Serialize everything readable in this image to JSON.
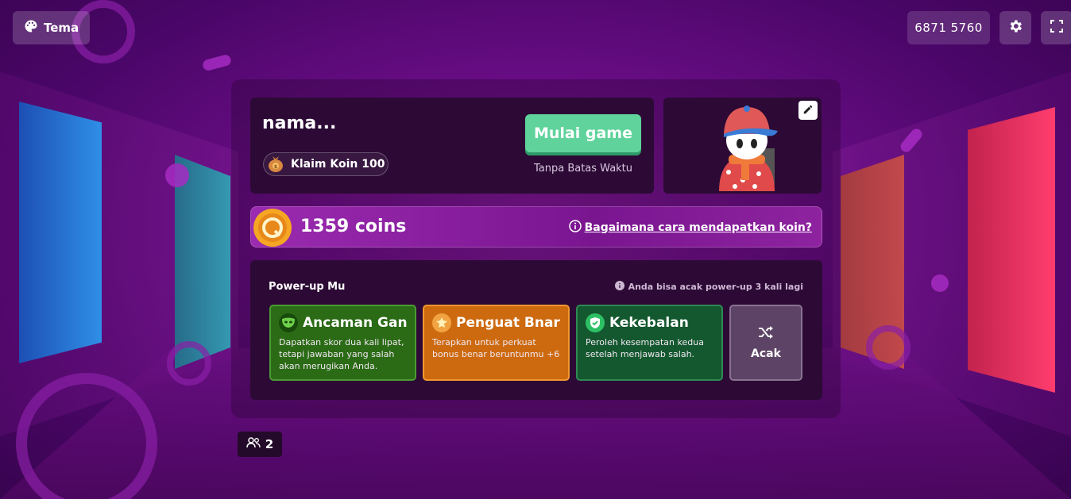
{
  "topbar": {
    "theme_label": "Tema",
    "game_code": "6871 5760"
  },
  "profile": {
    "name": "nama...",
    "claim_label": "Klaim Koin 100",
    "start_label": "Mulai game",
    "time_label": "Tanpa Batas Waktu"
  },
  "coins": {
    "label": "1359 coins",
    "help_label": "Bagaimana cara mendapatkan koin?"
  },
  "powerups": {
    "title": "Power-up Mu",
    "note": "Anda bisa acak power-up 3 kali lagi",
    "items": [
      {
        "title": "Ancaman Gan...",
        "desc": "Dapatkan skor dua kali lipat, tetapi jawaban yang salah akan merugikan Anda."
      },
      {
        "title": "Penguat Bnar ...",
        "desc": "Terapkan untuk perkuat bonus benar beruntunmu +6"
      },
      {
        "title": "Kekebalan",
        "desc": "Peroleh kesempatan kedua setelah menjawab salah."
      }
    ],
    "shuffle_label": "Acak"
  },
  "players": {
    "count": "2"
  },
  "colors": {
    "start_button": "#5fd39b",
    "powerup_green": "#2b6b16",
    "powerup_orange": "#cd6a0f",
    "powerup_teal": "#14582f"
  },
  "icons": {
    "theme": "palette-icon",
    "settings": "gear-icon",
    "fullscreen": "fullscreen-icon",
    "edit": "pencil-icon",
    "claim": "money-bag-icon",
    "coin": "coin-icon",
    "help": "info-icon",
    "shuffle": "shuffle-icon",
    "players": "users-icon"
  }
}
